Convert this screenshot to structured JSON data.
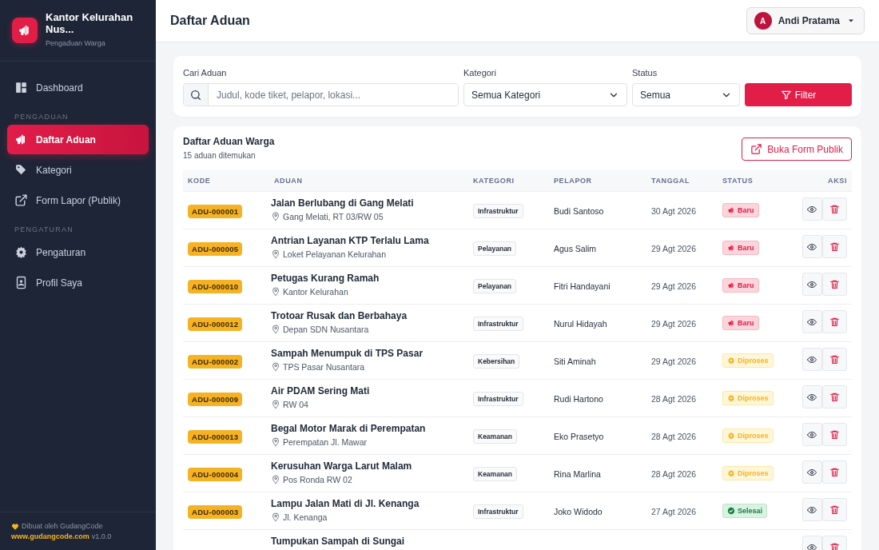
{
  "sidebar": {
    "brand": {
      "title": "Kantor Kelurahan Nus...",
      "subtitle": "Pengaduan Warga"
    },
    "sections": [
      {
        "items": [
          {
            "label": "Dashboard",
            "kind": "dashboard",
            "selected": false
          }
        ]
      },
      {
        "heading": "PENGADUAN",
        "items": [
          {
            "label": "Daftar Aduan",
            "kind": "megaphone",
            "selected": true
          },
          {
            "label": "Kategori",
            "kind": "tag",
            "selected": false
          },
          {
            "label": "Form Lapor (Publik)",
            "kind": "external",
            "selected": false
          }
        ]
      },
      {
        "heading": "PENGATURAN",
        "items": [
          {
            "label": "Pengaturan",
            "kind": "gear",
            "selected": false
          },
          {
            "label": "Profil Saya",
            "kind": "profile",
            "selected": false
          }
        ]
      }
    ],
    "footer": {
      "credit": "Dibuat oleh GudangCode",
      "link": "www.gudangcode.com",
      "version": "v1.0.0"
    }
  },
  "header": {
    "title": "Daftar Aduan",
    "user": {
      "initial": "A",
      "name": "Andi Pratama"
    }
  },
  "filters": {
    "search": {
      "label": "Cari Aduan",
      "placeholder": "Judul, kode tiket, pelapor, lokasi..."
    },
    "category": {
      "label": "Kategori",
      "value": "Semua Kategori"
    },
    "status": {
      "label": "Status",
      "value": "Semua"
    },
    "button": "Filter"
  },
  "table": {
    "title": "Daftar Aduan Warga",
    "count": "15 aduan ditemukan",
    "public_button": "Buka Form Publik",
    "columns": [
      "KODE",
      "ADUAN",
      "KATEGORI",
      "PELAPOR",
      "TANGGAL",
      "STATUS",
      "AKSI"
    ],
    "rows": [
      {
        "code": "ADU-000001",
        "title": "Jalan Berlubang di Gang Melati",
        "location": "Gang Melati, RT 03/RW 05",
        "category": "Infrastruktur",
        "reporter": "Budi Santoso",
        "date": "30 Agt 2026",
        "status": {
          "kind": "baru",
          "label": "Baru"
        }
      },
      {
        "code": "ADU-000005",
        "title": "Antrian Layanan KTP Terlalu Lama",
        "location": "Loket Pelayanan Kelurahan",
        "category": "Pelayanan",
        "reporter": "Agus Salim",
        "date": "29 Agt 2026",
        "status": {
          "kind": "baru",
          "label": "Baru"
        }
      },
      {
        "code": "ADU-000010",
        "title": "Petugas Kurang Ramah",
        "location": "Kantor Kelurahan",
        "category": "Pelayanan",
        "reporter": "Fitri Handayani",
        "date": "29 Agt 2026",
        "status": {
          "kind": "baru",
          "label": "Baru"
        }
      },
      {
        "code": "ADU-000012",
        "title": "Trotoar Rusak dan Berbahaya",
        "location": "Depan SDN Nusantara",
        "category": "Infrastruktur",
        "reporter": "Nurul Hidayah",
        "date": "29 Agt 2026",
        "status": {
          "kind": "baru",
          "label": "Baru"
        }
      },
      {
        "code": "ADU-000002",
        "title": "Sampah Menumpuk di TPS Pasar",
        "location": "TPS Pasar Nusantara",
        "category": "Kebersihan",
        "reporter": "Siti Aminah",
        "date": "29 Agt 2026",
        "status": {
          "kind": "diproses",
          "label": "Diproses"
        }
      },
      {
        "code": "ADU-000009",
        "title": "Air PDAM Sering Mati",
        "location": "RW 04",
        "category": "Infrastruktur",
        "reporter": "Rudi Hartono",
        "date": "28 Agt 2026",
        "status": {
          "kind": "diproses",
          "label": "Diproses"
        }
      },
      {
        "code": "ADU-000013",
        "title": "Begal Motor Marak di Perempatan",
        "location": "Perempatan Jl. Mawar",
        "category": "Keamanan",
        "reporter": "Eko Prasetyo",
        "date": "28 Agt 2026",
        "status": {
          "kind": "diproses",
          "label": "Diproses"
        }
      },
      {
        "code": "ADU-000004",
        "title": "Kerusuhan Warga Larut Malam",
        "location": "Pos Ronda RW 02",
        "category": "Keamanan",
        "reporter": "Rina Marlina",
        "date": "28 Agt 2026",
        "status": {
          "kind": "diproses",
          "label": "Diproses"
        }
      },
      {
        "code": "ADU-000003",
        "title": "Lampu Jalan Mati di Jl. Kenanga",
        "location": "Jl. Kenanga",
        "category": "Infrastruktur",
        "reporter": "Joko Widodo",
        "date": "27 Agt 2026",
        "status": {
          "kind": "selesai",
          "label": "Selesai"
        }
      },
      {
        "title": "Tumpukan Sampah di Sungai"
      }
    ]
  }
}
